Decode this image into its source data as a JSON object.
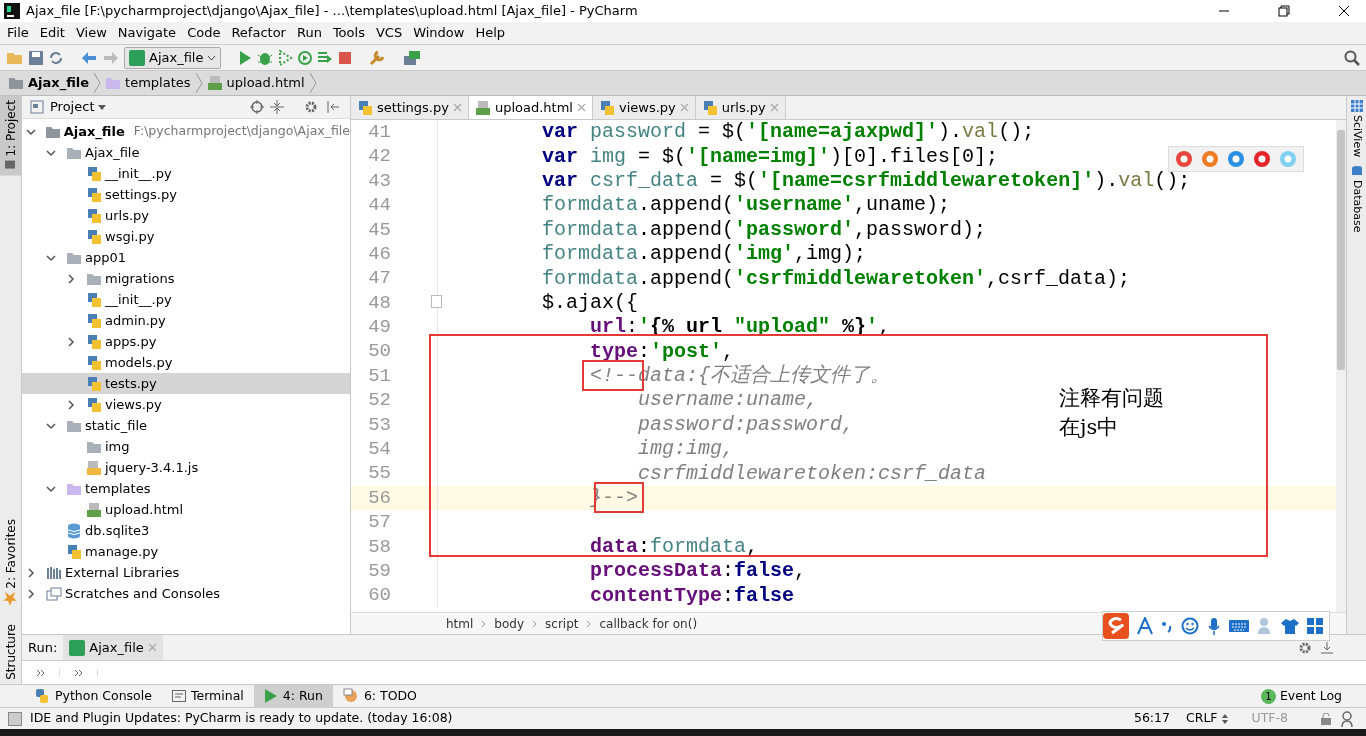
{
  "window": {
    "title": "Ajax_file [F:\\pycharmproject\\django\\Ajax_file] - ...\\templates\\upload.html [Ajax_file] - PyCharm"
  },
  "menu": [
    "File",
    "Edit",
    "View",
    "Navigate",
    "Code",
    "Refactor",
    "Run",
    "Tools",
    "VCS",
    "Window",
    "Help"
  ],
  "toolbar": {
    "run_config": "Ajax_file"
  },
  "navigation": [
    {
      "label": "Ajax_file",
      "kind": "root"
    },
    {
      "label": "templates",
      "kind": "template-folder"
    },
    {
      "label": "upload.html",
      "kind": "html"
    }
  ],
  "left_stripe": [
    {
      "label": "1: Project",
      "selected": true,
      "kind": "project"
    },
    {
      "label": "2: Favorites",
      "selected": false,
      "kind": "favorites"
    },
    {
      "label": "Structure",
      "selected": false,
      "kind": "structure"
    }
  ],
  "right_stripe": [
    {
      "label": "SciView",
      "kind": "sciview"
    },
    {
      "label": "Database",
      "kind": "database"
    }
  ],
  "project": {
    "title": "Project",
    "tree": [
      {
        "name": "Ajax_file",
        "path": "F:\\pycharmproject\\django\\Ajax_file",
        "kind": "root",
        "expanded": true,
        "selected": false,
        "children": [
          {
            "name": "Ajax_file",
            "kind": "folder",
            "expanded": true,
            "selected": false,
            "children": [
              {
                "name": "__init__.py",
                "kind": "py",
                "selected": false
              },
              {
                "name": "settings.py",
                "kind": "py",
                "selected": false
              },
              {
                "name": "urls.py",
                "kind": "py",
                "selected": false
              },
              {
                "name": "wsgi.py",
                "kind": "py",
                "selected": false
              }
            ]
          },
          {
            "name": "app01",
            "kind": "folder",
            "expanded": true,
            "selected": false,
            "children": [
              {
                "name": "migrations",
                "kind": "folder",
                "expanded": false,
                "selected": false
              },
              {
                "name": "__init__.py",
                "kind": "py",
                "selected": false
              },
              {
                "name": "admin.py",
                "kind": "py",
                "selected": false
              },
              {
                "name": "apps.py",
                "kind": "py",
                "expanded": false,
                "selected": false
              },
              {
                "name": "models.py",
                "kind": "py",
                "selected": false
              },
              {
                "name": "tests.py",
                "kind": "py",
                "selected": true
              },
              {
                "name": "views.py",
                "kind": "py",
                "expanded": false,
                "selected": false
              }
            ]
          },
          {
            "name": "static_file",
            "kind": "folder",
            "expanded": true,
            "selected": false,
            "children": [
              {
                "name": "img",
                "kind": "folder",
                "selected": false
              },
              {
                "name": "jquery-3.4.1.js",
                "kind": "js",
                "selected": false
              }
            ]
          },
          {
            "name": "templates",
            "kind": "template-folder",
            "expanded": true,
            "selected": false,
            "children": [
              {
                "name": "upload.html",
                "kind": "html",
                "selected": false
              }
            ]
          },
          {
            "name": "db.sqlite3",
            "kind": "db",
            "selected": false
          },
          {
            "name": "manage.py",
            "kind": "py",
            "selected": false
          }
        ]
      },
      {
        "name": "External Libraries",
        "kind": "lib",
        "expanded": false,
        "selected": false
      },
      {
        "name": "Scratches and Consoles",
        "kind": "scratch",
        "expanded": false,
        "selected": false
      }
    ]
  },
  "editor_tabs": [
    {
      "label": "settings.py",
      "kind": "py",
      "selected": false
    },
    {
      "label": "upload.html",
      "kind": "html",
      "selected": true
    },
    {
      "label": "views.py",
      "kind": "py",
      "selected": false
    },
    {
      "label": "urls.py",
      "kind": "py",
      "selected": false
    }
  ],
  "code": [
    {
      "number": "41",
      "tokens": [
        {
          "text": "        var ",
          "kind": "kw"
        },
        {
          "text": "password",
          "kind": "ident"
        },
        {
          "text": " = $(",
          "kind": "plain"
        },
        {
          "text": "'[name=ajaxpwd]'",
          "kind": "str"
        },
        {
          "text": ").",
          "kind": "plain"
        },
        {
          "text": "val",
          "kind": "method"
        },
        {
          "text": "();",
          "kind": "plain"
        }
      ]
    },
    {
      "number": "42",
      "tokens": [
        {
          "text": "        var ",
          "kind": "kw"
        },
        {
          "text": "img",
          "kind": "ident"
        },
        {
          "text": " = $(",
          "kind": "plain"
        },
        {
          "text": "'[name=img]'",
          "kind": "str"
        },
        {
          "text": ")[0].files[0];",
          "kind": "plain"
        }
      ]
    },
    {
      "number": "43",
      "tokens": [
        {
          "text": "        var ",
          "kind": "kw"
        },
        {
          "text": "csrf_data",
          "kind": "ident"
        },
        {
          "text": " = $(",
          "kind": "plain"
        },
        {
          "text": "'[name=csrfmiddlewaretoken]'",
          "kind": "str"
        },
        {
          "text": ").",
          "kind": "plain"
        },
        {
          "text": "val",
          "kind": "method"
        },
        {
          "text": "();",
          "kind": "plain"
        }
      ]
    },
    {
      "number": "44",
      "tokens": [
        {
          "text": "        formdata",
          "kind": "ident"
        },
        {
          "text": ".append(",
          "kind": "plain"
        },
        {
          "text": "'username'",
          "kind": "str"
        },
        {
          "text": ",uname);",
          "kind": "plain"
        }
      ]
    },
    {
      "number": "45",
      "tokens": [
        {
          "text": "        formdata",
          "kind": "ident"
        },
        {
          "text": ".append(",
          "kind": "plain"
        },
        {
          "text": "'password'",
          "kind": "str"
        },
        {
          "text": ",password);",
          "kind": "plain"
        }
      ]
    },
    {
      "number": "46",
      "tokens": [
        {
          "text": "        formdata",
          "kind": "ident"
        },
        {
          "text": ".append(",
          "kind": "plain"
        },
        {
          "text": "'img'",
          "kind": "str"
        },
        {
          "text": ",img);",
          "kind": "plain"
        }
      ]
    },
    {
      "number": "47",
      "tokens": [
        {
          "text": "        formdata",
          "kind": "ident"
        },
        {
          "text": ".append(",
          "kind": "plain"
        },
        {
          "text": "'csrfmiddlewaretoken'",
          "kind": "str"
        },
        {
          "text": ",csrf_data);",
          "kind": "plain"
        }
      ]
    },
    {
      "number": "48",
      "tokens": [
        {
          "text": "        $.ajax({",
          "kind": "plain"
        }
      ]
    },
    {
      "number": "49",
      "tokens": [
        {
          "text": "            url",
          "kind": "prop"
        },
        {
          "text": ":",
          "kind": "plain"
        },
        {
          "text": "'",
          "kind": "str"
        },
        {
          "text": "{% url ",
          "kind": "tmpl"
        },
        {
          "text": "\"upload\"",
          "kind": "str"
        },
        {
          "text": " %}",
          "kind": "tmpl"
        },
        {
          "text": "'",
          "kind": "str"
        },
        {
          "text": ",",
          "kind": "plain"
        }
      ]
    },
    {
      "number": "50",
      "boxed": true,
      "tokens": [
        {
          "text": "            type",
          "kind": "prop"
        },
        {
          "text": ":",
          "kind": "plain"
        },
        {
          "text": "'post'",
          "kind": "str"
        },
        {
          "text": ",",
          "kind": "plain"
        }
      ]
    },
    {
      "number": "51",
      "boxed": true,
      "tokens": [
        {
          "text": "            <!--",
          "kind": "comment",
          "marked": true
        },
        {
          "text": "data:{不适合上传文件了。",
          "kind": "comment"
        }
      ]
    },
    {
      "number": "52",
      "boxed": true,
      "tokens": [
        {
          "text": "                username:uname,",
          "kind": "comment"
        }
      ]
    },
    {
      "number": "53",
      "boxed": true,
      "tokens": [
        {
          "text": "                password:password,",
          "kind": "comment"
        }
      ]
    },
    {
      "number": "54",
      "boxed": true,
      "tokens": [
        {
          "text": "                img:img,",
          "kind": "comment"
        }
      ]
    },
    {
      "number": "55",
      "boxed": true,
      "tokens": [
        {
          "text": "                csrfmiddlewaretoken:csrf_data",
          "kind": "comment"
        }
      ]
    },
    {
      "number": "56",
      "boxed": true,
      "current": true,
      "tokens": [
        {
          "text": "            }",
          "kind": "comment"
        },
        {
          "text": "-->",
          "kind": "comment",
          "marked": true
        }
      ]
    },
    {
      "number": "57",
      "boxed": true
    },
    {
      "number": "58",
      "boxed": true,
      "tokens": [
        {
          "text": "            data",
          "kind": "prop"
        },
        {
          "text": ":",
          "kind": "plain"
        },
        {
          "text": "formdata",
          "kind": "ident"
        },
        {
          "text": ",",
          "kind": "plain"
        }
      ]
    },
    {
      "number": "59",
      "tokens": [
        {
          "text": "            processData",
          "kind": "prop"
        },
        {
          "text": ":",
          "kind": "plain"
        },
        {
          "text": "false",
          "kind": "kw"
        },
        {
          "text": ",",
          "kind": "plain"
        }
      ]
    },
    {
      "number": "60",
      "tokens": [
        {
          "text": "            contentType",
          "kind": "prop"
        },
        {
          "text": ":",
          "kind": "plain"
        },
        {
          "text": "false",
          "kind": "kw"
        }
      ]
    }
  ],
  "note": [
    "注释有问题",
    "在js中"
  ],
  "code_path": [
    "html",
    "body",
    "script",
    "callback for on()"
  ],
  "run_panel": {
    "label": "Run:",
    "tab": "Ajax_file"
  },
  "tool_tabs": [
    {
      "label": "Python Console",
      "kind": "python",
      "selected": false
    },
    {
      "label": "Terminal",
      "kind": "terminal",
      "selected": false
    },
    {
      "label": "4: Run",
      "kind": "run",
      "selected": true
    },
    {
      "label": "6: TODO",
      "kind": "todo",
      "selected": false
    }
  ],
  "event_log": {
    "count": "1",
    "label": "Event Log"
  },
  "status_bar": {
    "message": "IDE and Plugin Updates: PyCharm is ready to update. (today 16:08)",
    "position": "56:17",
    "line_separator": "CRLF",
    "encoding": "UTF-8"
  }
}
